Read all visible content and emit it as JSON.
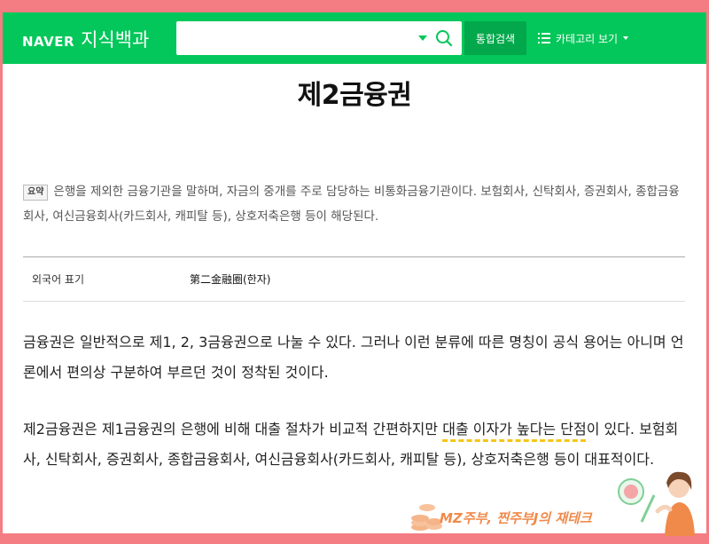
{
  "header": {
    "logo_brand": "NAVER",
    "logo_service": "지식백과",
    "search": {
      "value": "",
      "placeholder": ""
    },
    "search_button_label": "통합검색",
    "category_button_label": "카테고리 보기"
  },
  "article": {
    "title": "제2금융권",
    "summary_badge": "요약",
    "summary_text": "은행을 제외한 금융기관을 말하며, 자금의 중개를 주로 담당하는 비통화금융기관이다. 보험회사, 신탁회사, 증권회사, 종합금융회사, 여신금융회사(카드회사, 캐피탈 등), 상호저축은행 등이 해당된다.",
    "info": {
      "label": "외국어 표기",
      "value": "第二金融圈(한자)"
    },
    "paragraph1": "금융권은 일반적으로 제1, 2, 3금융권으로 나눌 수 있다. 그러나 이런 분류에 따른 명칭이 공식 용어는 아니며 언론에서 편의상 구분하여 부르던 것이 정착된 것이다.",
    "paragraph2_before": "제2금융권은 제1금융권의 은행에 비해 대출 절차가 비교적 간편하지만 ",
    "paragraph2_highlight": "대출 이자가 높다는 단점",
    "paragraph2_after": "이 있다. 보험회사, 신탁회사, 증권회사, 종합금융회사, 여신금융회사(카드회사, 캐피탈 등), 상호저축은행 등이 대표적이다."
  },
  "watermark": {
    "text": "MZ주부, 찐주부J의 재테크"
  },
  "colors": {
    "naver_green": "#03c75a",
    "frame_pink": "#f47c83",
    "highlight": "#f5c518"
  },
  "icons": [
    "search-icon",
    "caret-down-icon",
    "list-icon",
    "chevron-down-icon",
    "coins-icon",
    "person-illustration"
  ]
}
